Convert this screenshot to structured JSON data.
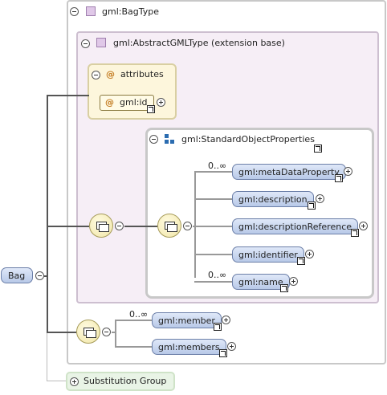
{
  "bag_type": {
    "title": "gml:BagType"
  },
  "abstract_type": {
    "title": "gml:AbstractGMLType (extension base)"
  },
  "attributes": {
    "title": "attributes",
    "at_symbol": "@",
    "id_attr": "gml:id"
  },
  "standard_props": {
    "title": "gml:StandardObjectProperties",
    "multiplicity_top": "0..∞",
    "multiplicity_bottom": "0..∞",
    "items": [
      "gml:metaDataProperty",
      "gml:description",
      "gml:descriptionReference",
      "gml:identifier",
      "gml:name"
    ]
  },
  "bag_members": {
    "multiplicity": "0..∞",
    "items": [
      "gml:member",
      "gml:members"
    ]
  },
  "root": {
    "label": "Bag"
  },
  "substitution": {
    "label": "Substitution Group"
  },
  "colors": {
    "pill_border": "#6c7fa8",
    "attr_bg": "#fdf6dc",
    "panel_border": "#bbbbbb"
  }
}
